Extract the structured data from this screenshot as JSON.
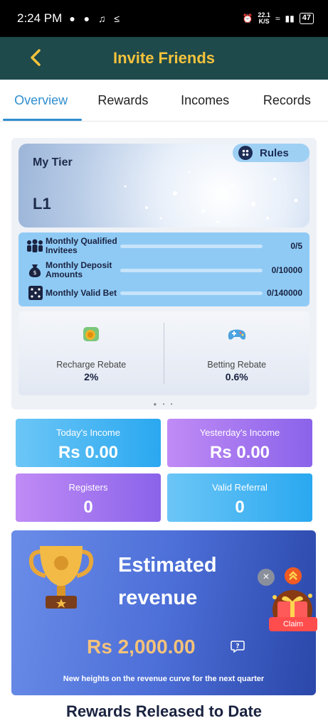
{
  "statusbar": {
    "time": "2:24 PM",
    "speed_top": "22.1",
    "speed_bottom": "K/S",
    "battery": "47"
  },
  "header": {
    "title": "Invite Friends"
  },
  "tabs": [
    {
      "label": "Overview",
      "active": true
    },
    {
      "label": "Rewards",
      "active": false
    },
    {
      "label": "Incomes",
      "active": false
    },
    {
      "label": "Records",
      "active": false
    }
  ],
  "tier": {
    "title": "My Tier",
    "level": "L1",
    "rules_label": "Rules",
    "requirements": [
      {
        "label": "Monthly Qualified Invitees",
        "value": "0/5",
        "progress": 0
      },
      {
        "label": "Monthly Deposit Amounts",
        "value": "0/10000",
        "progress": 0
      },
      {
        "label": "Monthly Valid Bet",
        "value": "0/140000",
        "progress": 0
      }
    ],
    "rebates": [
      {
        "label": "Recharge Rebate",
        "value": "2%"
      },
      {
        "label": "Betting Rebate",
        "value": "0.6%"
      }
    ]
  },
  "stats": {
    "today_income": {
      "label": "Today's Income",
      "value": "Rs 0.00"
    },
    "yesterday_income": {
      "label": "Yesterday's Income",
      "value": "Rs 0.00"
    },
    "registers": {
      "label": "Registers",
      "value": "0"
    },
    "valid_referral": {
      "label": "Valid Referral",
      "value": "0"
    }
  },
  "revenue": {
    "title": "Estimated revenue",
    "amount": "Rs 2,000.00",
    "note": "New heights on the revenue curve for the next quarter"
  },
  "floating": {
    "claim_label": "Claim"
  },
  "bottom": {
    "title": "Rewards Released to Date"
  },
  "colors": {
    "header_bg": "#1e4a4c",
    "header_title": "#f5c33b",
    "accent": "#2f8ecf"
  }
}
